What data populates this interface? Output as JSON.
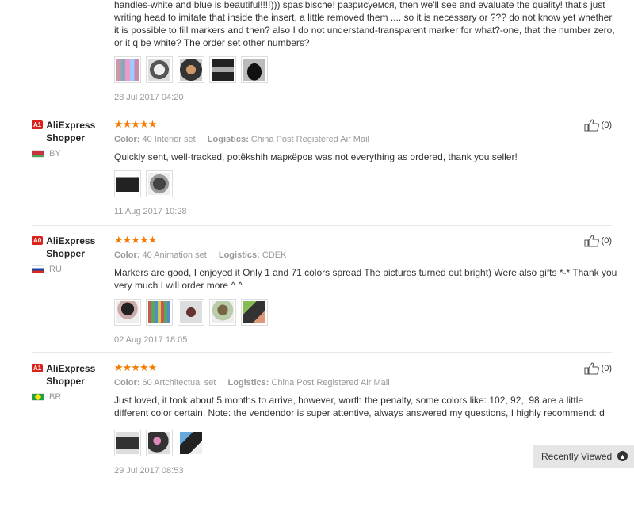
{
  "top_review": {
    "text": "handles-white and blue is beautiful!!!!))) spasibische! разрисуемся, then we'll see and evaluate the quality! that's just writing head to imitate that inside the insert, a little removed them .... so it is necessary or ??? do not know yet whether it is possible to fill markers and then? also I do not understand-transparent marker for what?-one, that the number zero, or it q be white? The order set other numbers?",
    "date": "28 Jul 2017 04:20"
  },
  "reviews": [
    {
      "badge": "A1",
      "user": "AliExpress Shopper",
      "country": "BY",
      "stars": "★★★★★",
      "color_label": "Color:",
      "color_value": "40 Interior set",
      "logistics_label": "Logistics:",
      "logistics_value": "China Post Registered Air Mail",
      "text": "Quickly sent, well-tracked, potëkshih маркёров was not everything as ordered, thank you seller!",
      "date": "11 Aug 2017 10:28",
      "likes": "(0)"
    },
    {
      "badge": "A0",
      "user": "AliExpress Shopper",
      "country": "RU",
      "stars": "★★★★★",
      "color_label": "Color:",
      "color_value": "40 Animation set",
      "logistics_label": "Logistics:",
      "logistics_value": "CDEK",
      "text": "Markers are good, I enjoyed it Only 1 and 71 colors spread The pictures turned out bright) Were also gifts *-* Thank you very much I will order more ^ ^",
      "date": "02 Aug 2017 18:05",
      "likes": "(0)"
    },
    {
      "badge": "A1",
      "user": "AliExpress Shopper",
      "country": "BR",
      "stars": "★★★★★",
      "color_label": "Color:",
      "color_value": "60 Artchitectual set",
      "logistics_label": "Logistics:",
      "logistics_value": "China Post Registered Air Mail",
      "text": "Just loved, it took about 5 months to arrive, however, worth the penalty, some colors like: 102, 92,, 98 are a little different color certain. Note: the vendendor is super attentive, always answered my questions, I highly recommend: d",
      "date": "29 Jul 2017 08:53",
      "likes": "(0)"
    }
  ],
  "recently_viewed": "Recently Viewed",
  "colors": {
    "star": "#f47a00",
    "badge": "#d9231b"
  }
}
